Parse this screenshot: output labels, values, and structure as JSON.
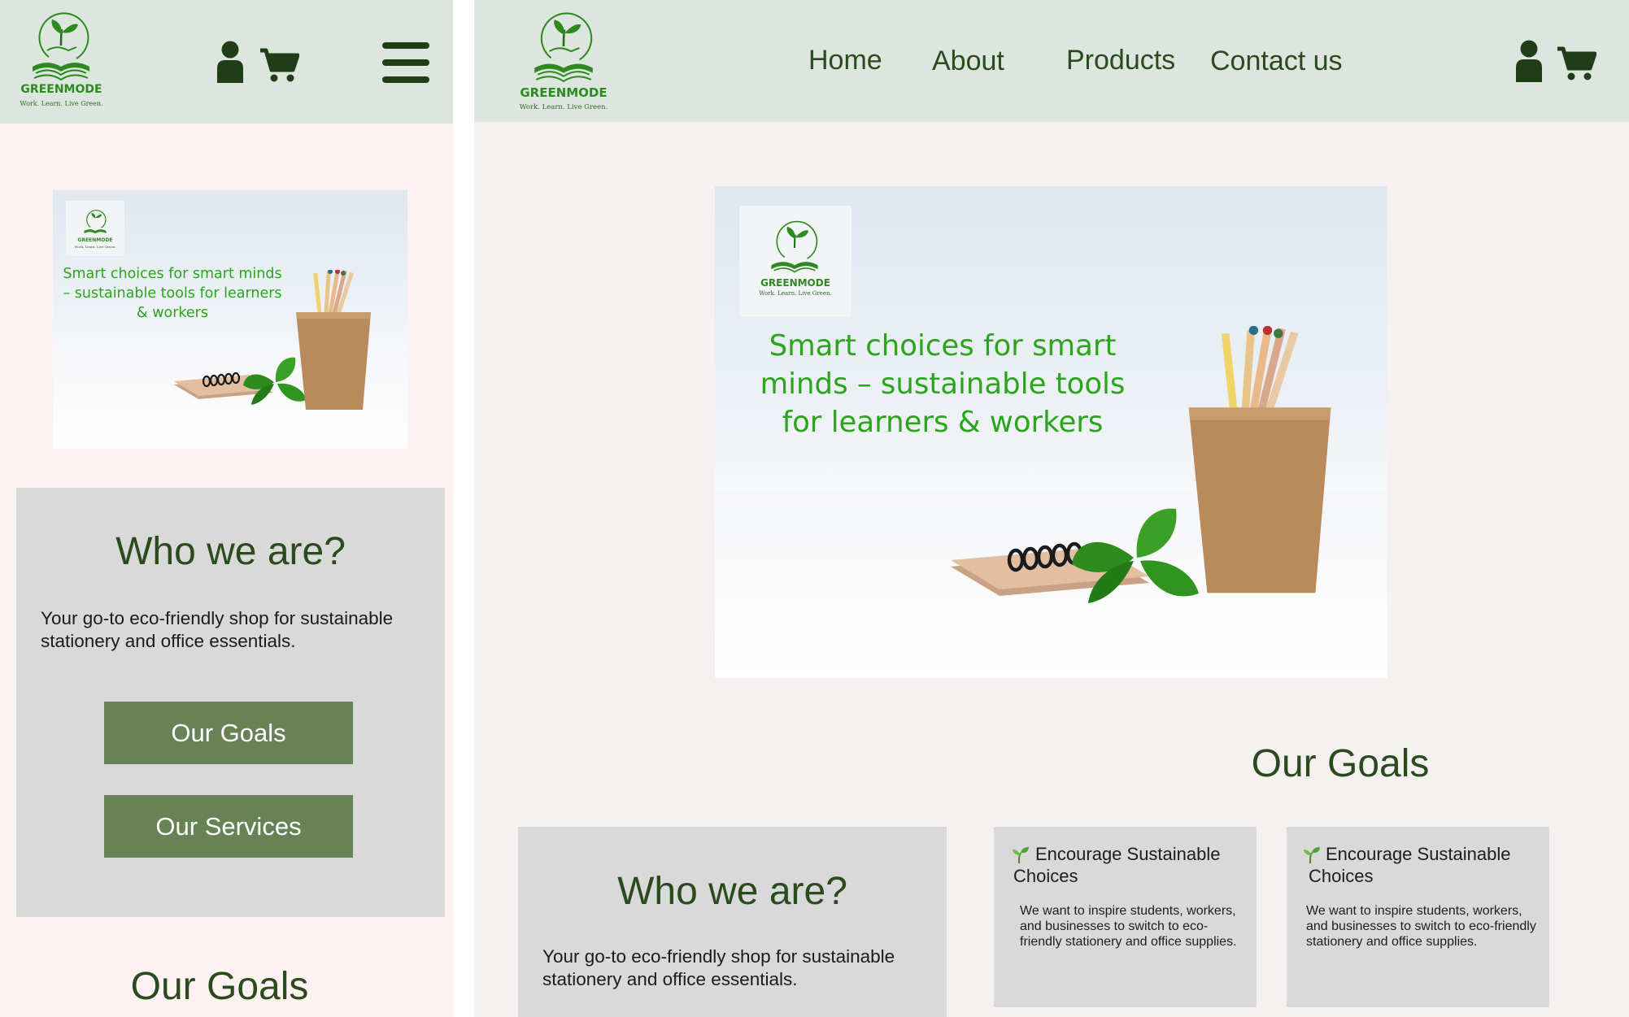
{
  "brand": {
    "name": "GREENMODE",
    "tagline": "Work. Learn. Live Green.",
    "colors": {
      "accent": "#678356",
      "header_bg": "#dde6de",
      "text_dark": "#2b4a1d",
      "logo_green": "#2d8a1f",
      "hero_text": "#2aa51c"
    }
  },
  "hero": {
    "caption": "Smart choices for smart minds – sustainable tools for learners & workers"
  },
  "mobile": {
    "header": {
      "icons": [
        "user-icon",
        "cart-icon",
        "hamburger-menu-icon"
      ]
    },
    "who": {
      "title": "Who we are?",
      "text": "Your go-to eco-friendly shop for sustainable stationery and office essentials."
    },
    "buttons": {
      "goals": "Our Goals",
      "services": "Our Services"
    },
    "goals_heading": "Our Goals"
  },
  "desktop": {
    "nav": {
      "home": "Home",
      "about": "About",
      "products": "Products",
      "contact": "Contact us"
    },
    "header_icons": [
      "user-icon",
      "cart-icon"
    ],
    "goals_heading": "Our Goals",
    "who": {
      "title": "Who we are?",
      "text": "Your go-to eco-friendly shop for sustainable stationery and office essentials."
    },
    "goal_cards": [
      {
        "icon": "seedling-icon",
        "title": "Encourage Sustainable Choices",
        "text": "We want to inspire students, workers, and businesses to switch to eco-friendly stationery and office supplies."
      },
      {
        "icon": "seedling-icon",
        "title": "Encourage Sustainable Choices",
        "text": "We want to inspire students, workers, and businesses to switch to eco-friendly stationery and office supplies."
      }
    ]
  }
}
